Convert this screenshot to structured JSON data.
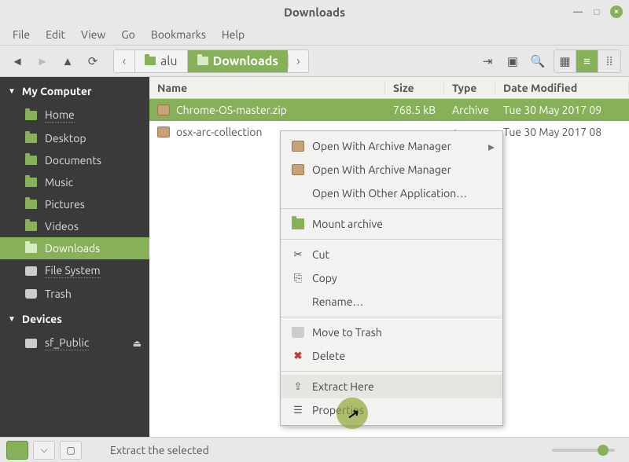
{
  "window": {
    "title": "Downloads"
  },
  "menubar": [
    "File",
    "Edit",
    "View",
    "Go",
    "Bookmarks",
    "Help"
  ],
  "path": {
    "segments": [
      {
        "label": "alu",
        "active": false
      },
      {
        "label": "Downloads",
        "active": true
      }
    ]
  },
  "sidebar": {
    "groups": [
      {
        "title": "My Computer",
        "items": [
          {
            "label": "Home",
            "icon": "folder",
            "underline": true
          },
          {
            "label": "Desktop",
            "icon": "folder"
          },
          {
            "label": "Documents",
            "icon": "folder"
          },
          {
            "label": "Music",
            "icon": "folder"
          },
          {
            "label": "Pictures",
            "icon": "folder"
          },
          {
            "label": "Videos",
            "icon": "folder"
          },
          {
            "label": "Downloads",
            "icon": "folder",
            "selected": true
          },
          {
            "label": "File System",
            "icon": "drive",
            "underline": true
          },
          {
            "label": "Trash",
            "icon": "trash"
          }
        ]
      },
      {
        "title": "Devices",
        "items": [
          {
            "label": "sf_Public",
            "icon": "drive",
            "underline": true,
            "ejectable": true
          }
        ]
      }
    ]
  },
  "columns": {
    "name": "Name",
    "size": "Size",
    "type": "Type",
    "date": "Date Modified"
  },
  "files": [
    {
      "name": "Chrome-OS-master.zip",
      "size": "768.5 kB",
      "type": "Archive",
      "date": "Tue 30 May 2017 09",
      "selected": true
    },
    {
      "name": "osx-arc-collection",
      "size": "",
      "type": "e",
      "date": "Tue 30 May 2017 08"
    }
  ],
  "context_menu": [
    {
      "label": "Open With Archive Manager",
      "icon": "pkg",
      "submenu": true
    },
    {
      "label": "Open With Archive Manager",
      "icon": "pkg"
    },
    {
      "label": "Open With Other Application…",
      "icon": ""
    },
    {
      "sep": true
    },
    {
      "label": "Mount archive",
      "icon": "fld"
    },
    {
      "sep": true
    },
    {
      "label": "Cut",
      "icon": "cut"
    },
    {
      "label": "Copy",
      "icon": "copy"
    },
    {
      "label": "Rename…",
      "icon": ""
    },
    {
      "sep": true
    },
    {
      "label": "Move to Trash",
      "icon": "trash"
    },
    {
      "label": "Delete",
      "icon": "red"
    },
    {
      "sep": true
    },
    {
      "label": "Extract Here",
      "icon": "extract",
      "highlight": true
    },
    {
      "label": "Properties",
      "icon": "extract"
    }
  ],
  "statusbar": {
    "text": "Extract the selected"
  }
}
